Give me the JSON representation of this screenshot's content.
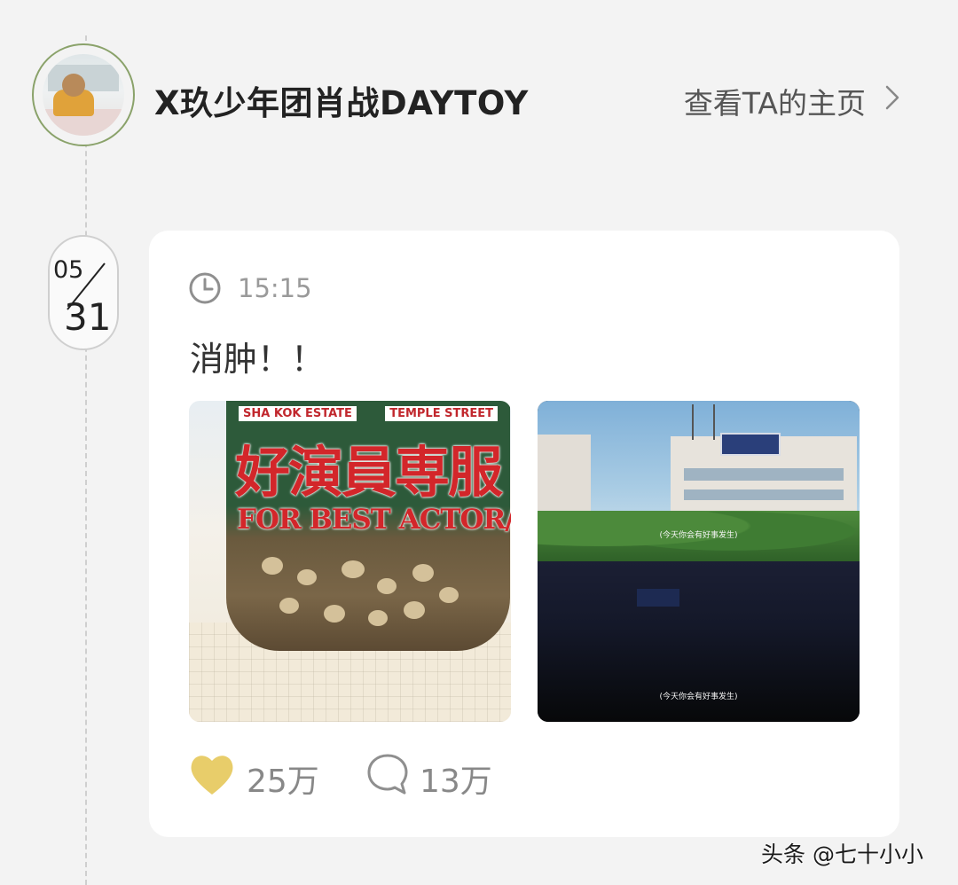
{
  "profile": {
    "username": "X玖少年团肖战DAYTOY",
    "view_profile_label": "查看TA的主页",
    "avatar_icon": "user-avatar"
  },
  "post": {
    "date_month": "05",
    "date_day": "31",
    "time": "15:15",
    "text": "消肿！！",
    "images": [
      {
        "jar_label_left": "SHA KOK ESTATE",
        "jar_label_right": "TEMPLE STREET",
        "jar_title": "好演員専服",
        "jar_subtitle": "FOR BEST ACTOR/RESS"
      },
      {
        "caption_top": "(今天你会有好事发生)",
        "caption_bottom": "(今天你会有好事发生)"
      }
    ],
    "likes": "25万",
    "comments": "13万"
  },
  "colors": {
    "like_heart": "#e8cd6a",
    "avatar_ring": "#8aa26a",
    "jar_red": "#d3262a"
  },
  "watermark": "头条 @七十小小"
}
